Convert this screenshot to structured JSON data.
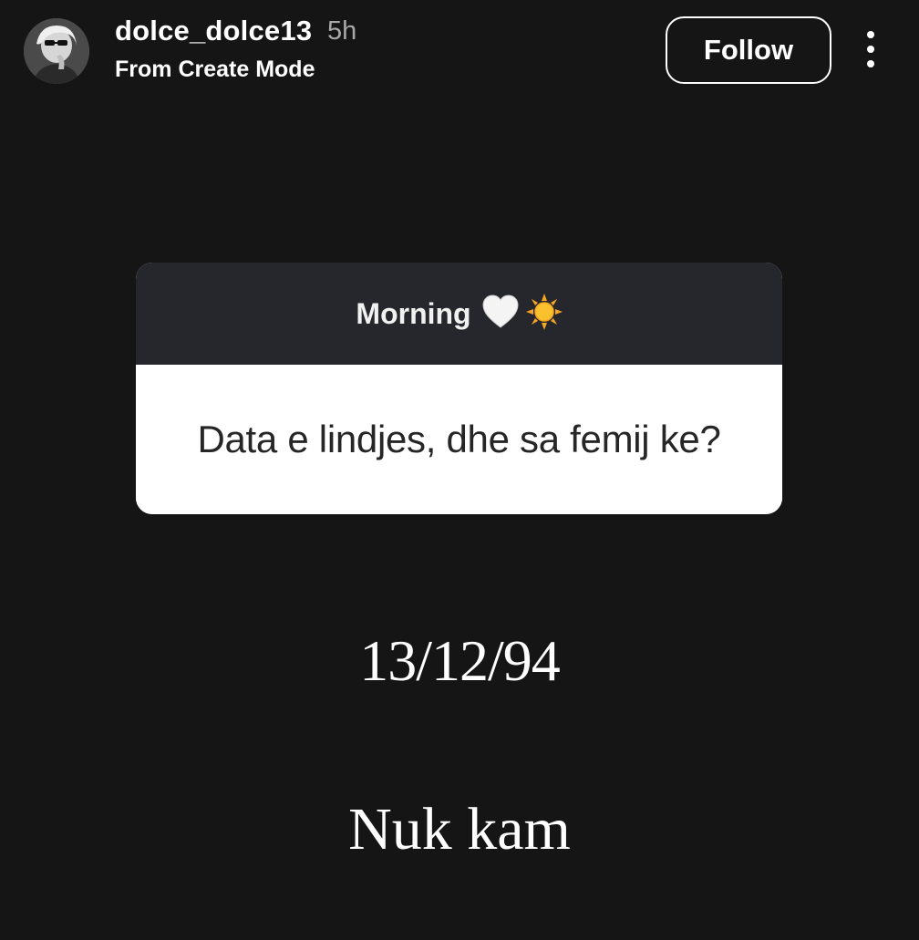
{
  "header": {
    "username": "dolce_dolce13",
    "timestamp": "5h",
    "subtitle": "From Create Mode",
    "follow_label": "Follow",
    "more_icon": "more-vertical-icon",
    "avatar": "profile-avatar"
  },
  "question_sticker": {
    "title": "Morning",
    "title_emojis": [
      "white-heart-icon",
      "sun-icon"
    ],
    "question": "Data e lindjes, dhe sa femij ke?"
  },
  "answers": {
    "date": "13/12/94",
    "children": "Nuk kam"
  },
  "colors": {
    "background": "#151515",
    "sticker_header": "#26272c",
    "sticker_body": "#ffffff",
    "timestamp": "#a8a8a8"
  }
}
